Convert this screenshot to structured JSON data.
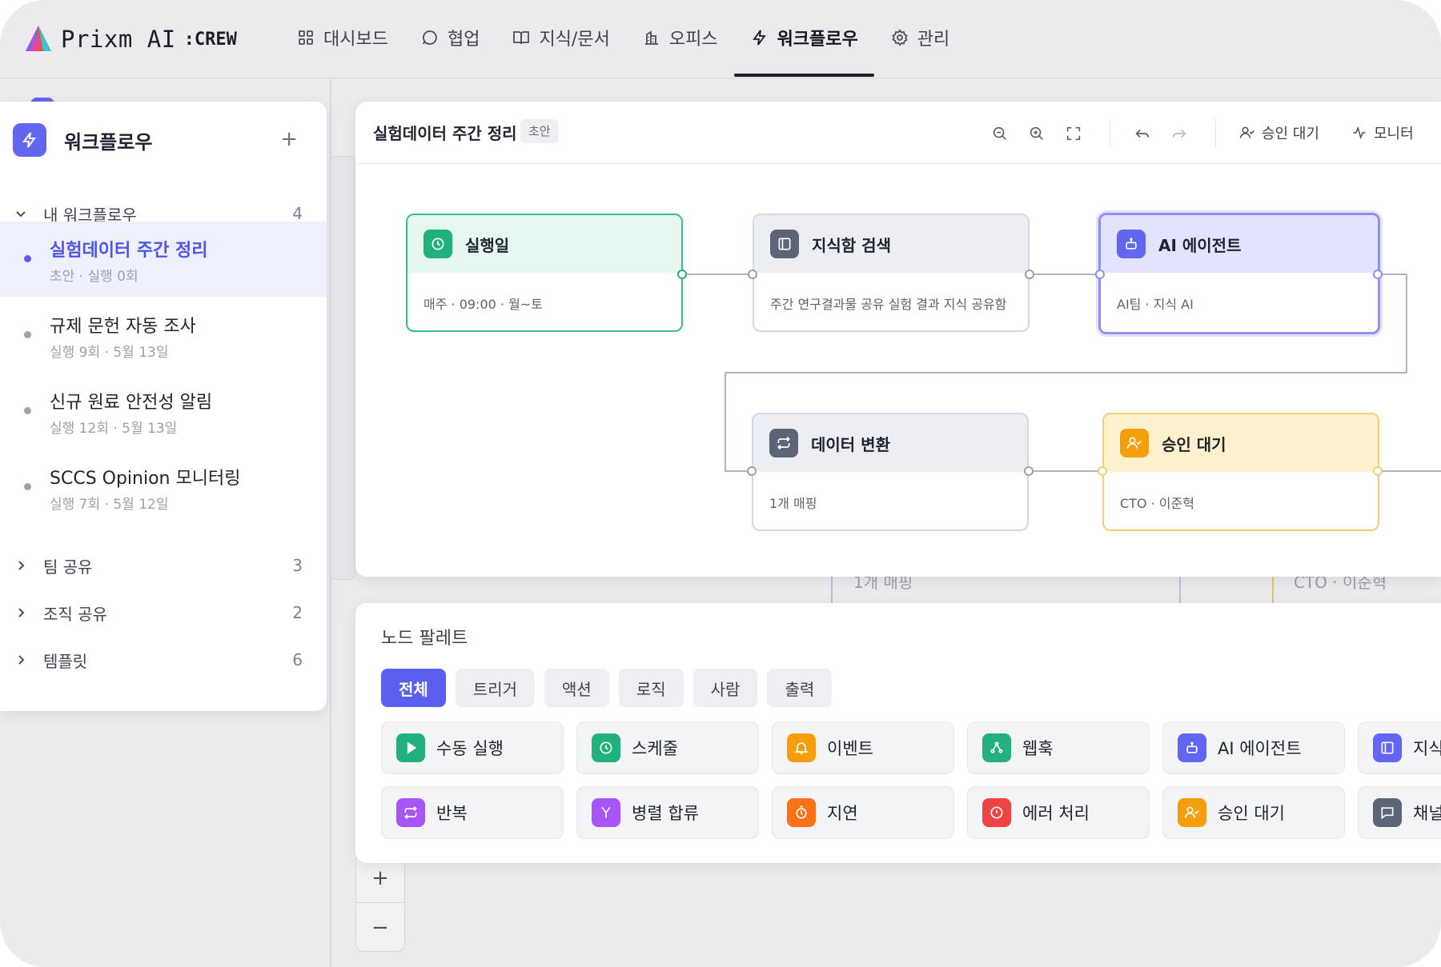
{
  "brand": {
    "name": "Prixm AI",
    "suffix": ":CREW"
  },
  "nav": [
    {
      "label": "대시보드",
      "icon": "grid-icon"
    },
    {
      "label": "협업",
      "icon": "chat-icon"
    },
    {
      "label": "지식/문서",
      "icon": "book-icon"
    },
    {
      "label": "오피스",
      "icon": "building-icon"
    },
    {
      "label": "워크플로우",
      "icon": "lightning-icon",
      "active": true
    },
    {
      "label": "관리",
      "icon": "gear-icon"
    }
  ],
  "sidebar": {
    "title": "워크플로우",
    "groups": [
      {
        "label": "내 워크플로우",
        "count": "4",
        "expanded": true
      },
      {
        "label": "팀 공유",
        "count": "3"
      },
      {
        "label": "조직 공유",
        "count": "2"
      },
      {
        "label": "템플릿",
        "count": "6"
      }
    ],
    "items": [
      {
        "name": "실험데이터 주간 정리",
        "meta": "초안 · 실행 0회",
        "active": true
      },
      {
        "name": "규제 문헌 자동 조사",
        "meta": "실행 9회 · 5월 13일"
      },
      {
        "name": "신규 원료 안전성 알림",
        "meta": "실행 12회 · 5월 13일"
      },
      {
        "name": "SCCS Opinion 모니터링",
        "meta": "실행 7회 · 5월 12일"
      }
    ]
  },
  "editor": {
    "title": "실험데이터 주간 정리",
    "badge": "초안",
    "approval_label": "승인 대기",
    "monitor_label": "모니터",
    "nodes": [
      {
        "title": "실행일",
        "body": "매주 · 09:00 · 월~토",
        "color": "#22b07d",
        "icon": "clock-icon"
      },
      {
        "title": "지식함 검색",
        "body": "주간 연구결과물 공유 실험 결과 지식 공유함",
        "color": "#5c6478",
        "icon": "library-icon"
      },
      {
        "title": "AI 에이전트",
        "body": "AI팀 · 지식 AI",
        "color": "#6366f1",
        "icon": "robot-icon"
      },
      {
        "title": "데이터 변환",
        "body": "1개 매핑",
        "color": "#5c6478",
        "icon": "transform-icon"
      },
      {
        "title": "승인 대기",
        "body": "CTO · 이준혁",
        "color": "#f59e0b",
        "icon": "user-check-icon"
      }
    ]
  },
  "background": {
    "ghost_text_1": "1개 매핑",
    "ghost_text_2": "CTO · 이준혁"
  },
  "palette": {
    "title": "노드 팔레트",
    "tabs": [
      "전체",
      "트리거",
      "액션",
      "로직",
      "사람",
      "출력"
    ],
    "items": [
      {
        "label": "수동 실행",
        "color": "#22b07d",
        "icon": "play-icon"
      },
      {
        "label": "스케줄",
        "color": "#22b07d",
        "icon": "clock-icon"
      },
      {
        "label": "이벤트",
        "color": "#f59e0b",
        "icon": "bell-icon"
      },
      {
        "label": "웹훅",
        "color": "#22b07d",
        "icon": "webhook-icon"
      },
      {
        "label": "AI 에이전트",
        "color": "#6366f1",
        "icon": "robot-icon"
      },
      {
        "label": "지식",
        "color": "#6366f1",
        "icon": "library-icon"
      },
      {
        "label": "반복",
        "color": "#a855f7",
        "icon": "repeat-icon"
      },
      {
        "label": "병렬 합류",
        "color": "#a855f7",
        "icon": "merge-icon"
      },
      {
        "label": "지연",
        "color": "#f97316",
        "icon": "timer-icon"
      },
      {
        "label": "에러 처리",
        "color": "#ef4444",
        "icon": "alert-icon"
      },
      {
        "label": "승인 대기",
        "color": "#f59e0b",
        "icon": "user-check-icon"
      },
      {
        "label": "채널",
        "color": "#5c6478",
        "icon": "message-icon"
      }
    ]
  }
}
